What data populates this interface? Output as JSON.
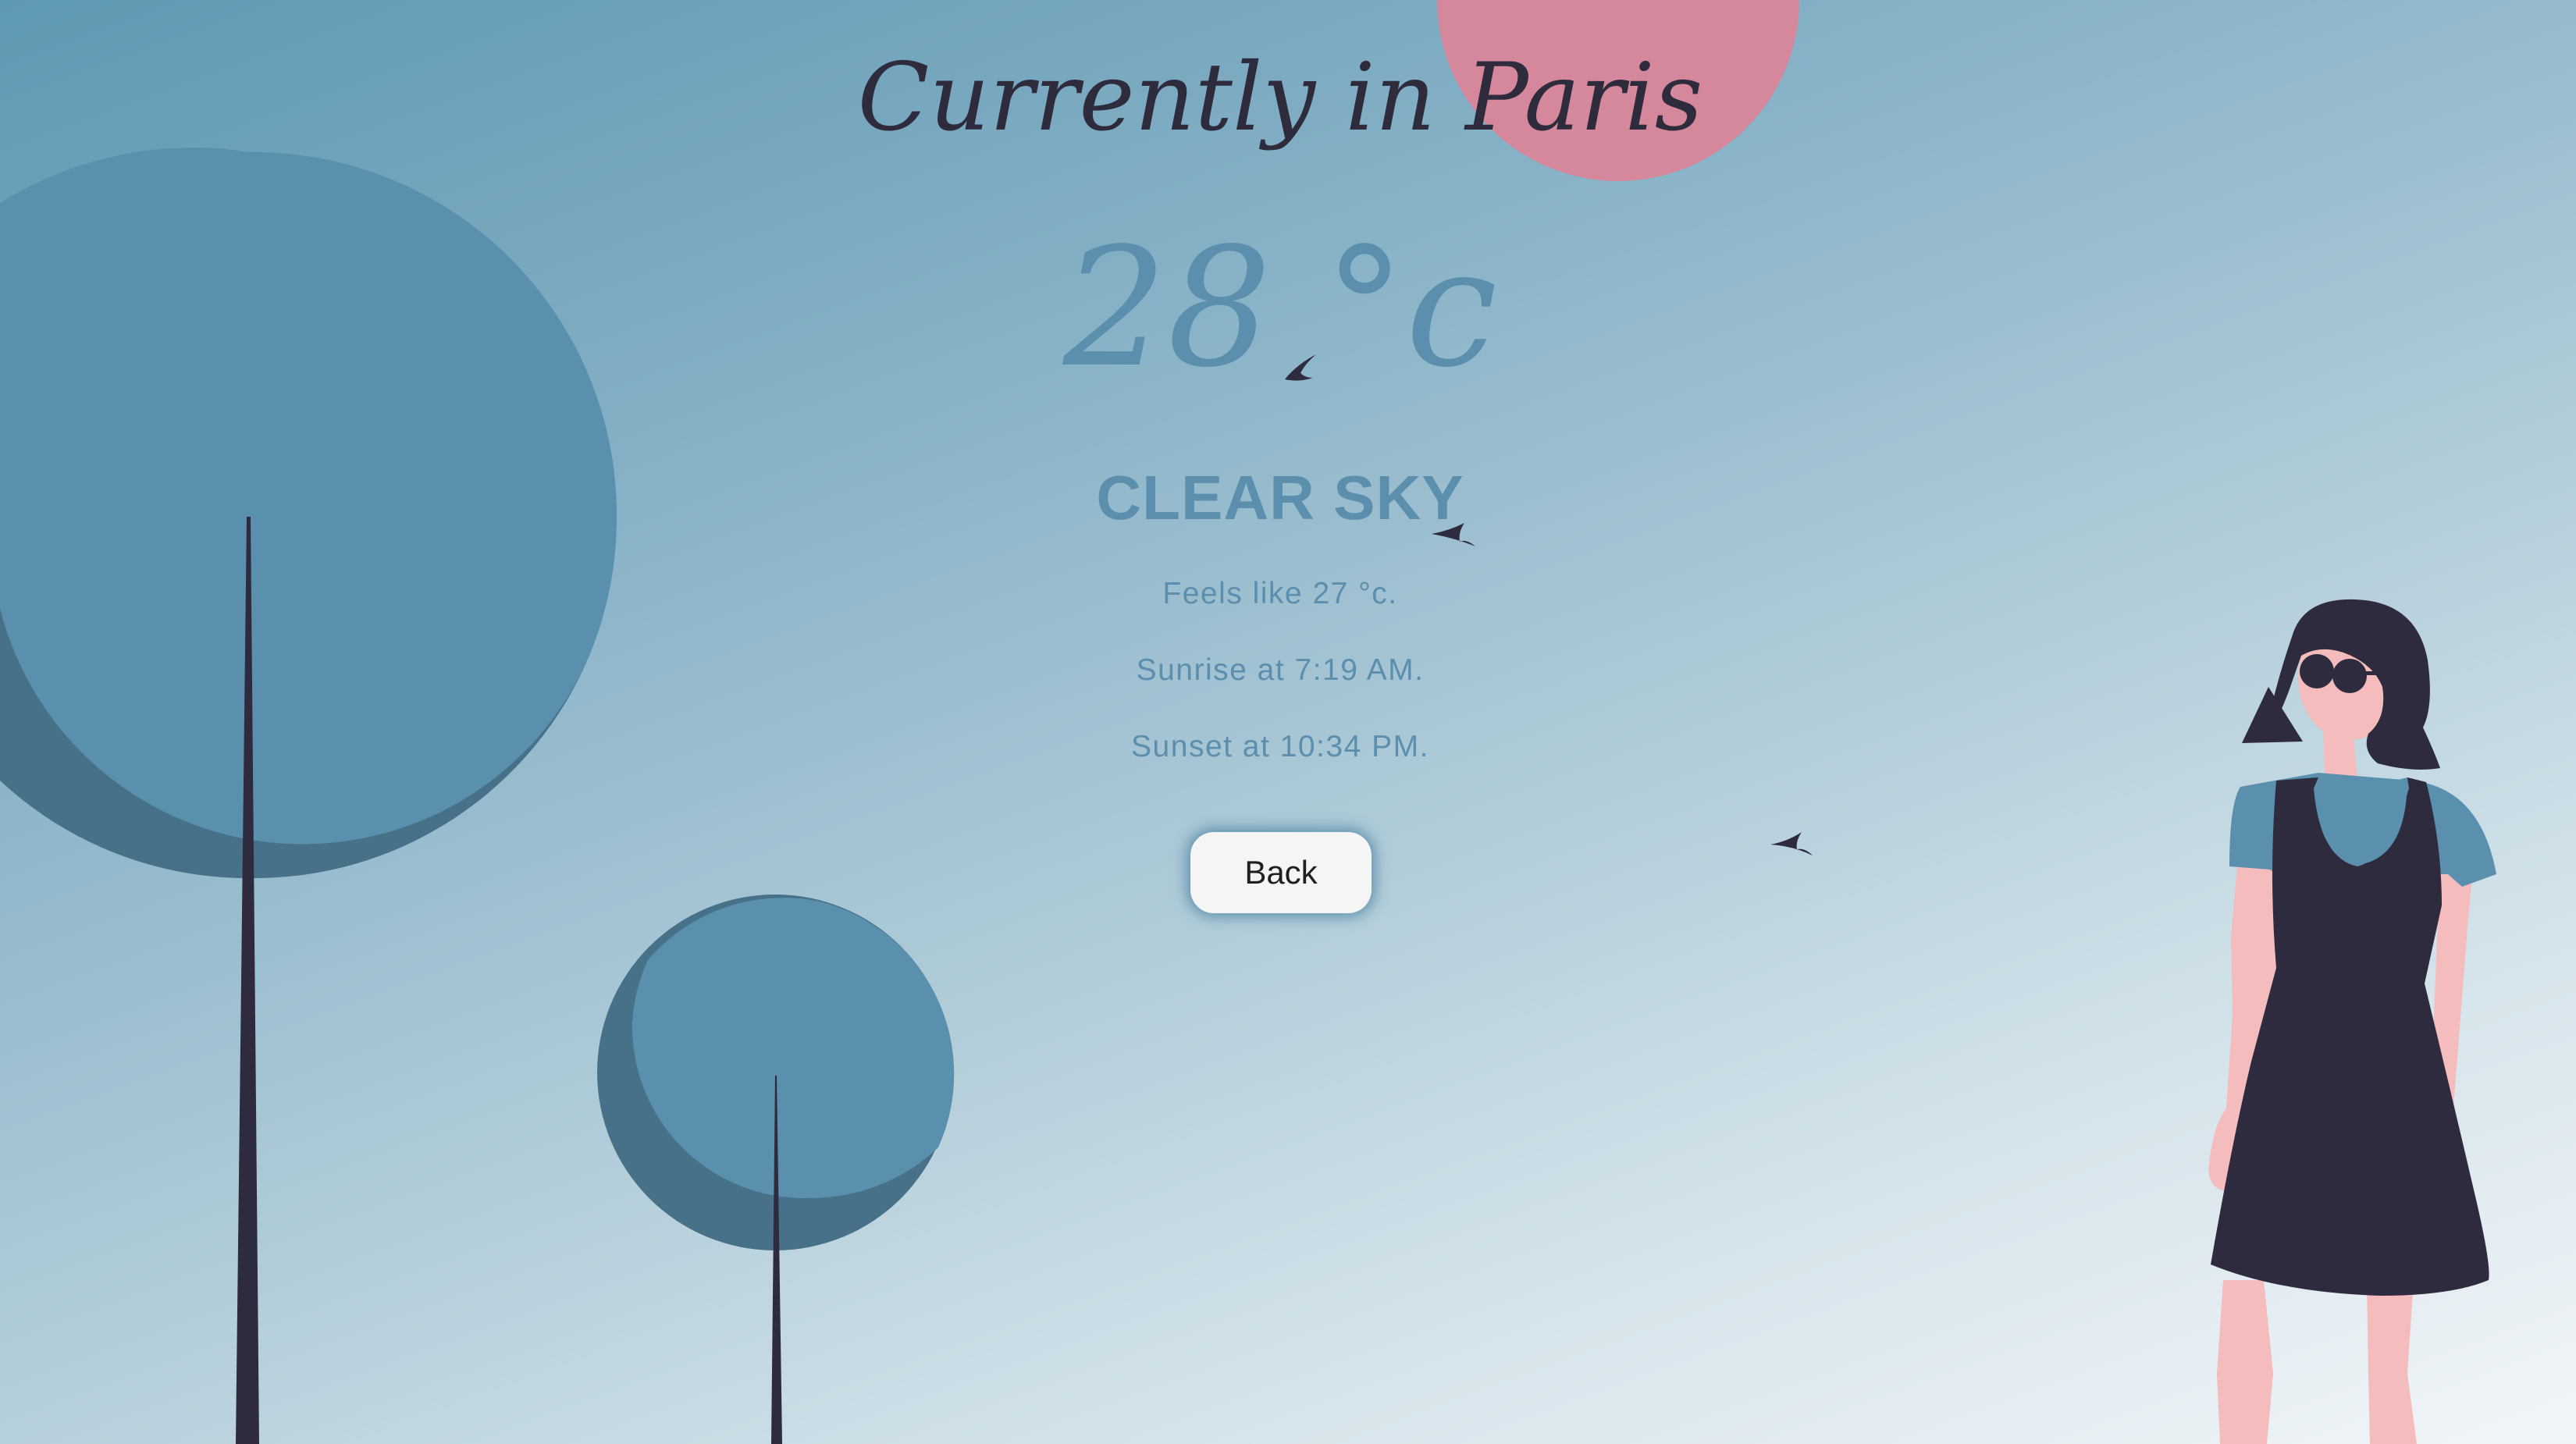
{
  "header": {
    "title": "Currently in Paris"
  },
  "weather": {
    "temperature": "28 °c",
    "description": "CLEAR SKY",
    "feels_like": "Feels like 27 °c.",
    "sunrise": "Sunrise at 7:19 AM.",
    "sunset": "Sunset at 10:34 PM."
  },
  "actions": {
    "back_label": "Back"
  },
  "colors": {
    "title": "#2e2b3c",
    "accent": "#5b8fad",
    "tree_light": "#5a90ae",
    "tree_shadow": "#467189",
    "sun": "#d5879b",
    "dress": "#2f2b3e",
    "skin": "#f4bcbc"
  },
  "decorations": {
    "icons": [
      "sun-icon",
      "tree-icon",
      "bird-icon",
      "woman-illustration"
    ]
  }
}
